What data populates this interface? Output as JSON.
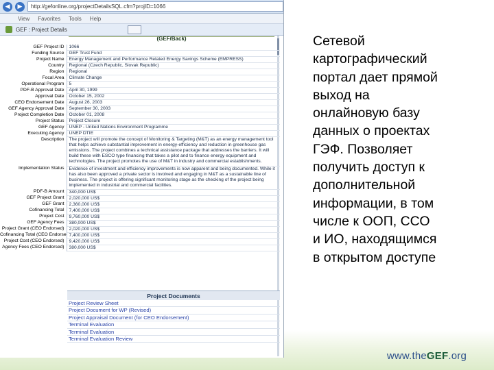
{
  "slide": {
    "lines": [
      "Сетевой",
      "картографический",
      "портал дает прямой",
      "выход на",
      "онлайновую базу",
      "данных о проектах",
      "ГЭФ. Позволяет",
      "получить доступ к",
      "дополнительной",
      "информации, в том",
      "числе к ООП, ССО",
      "и ИО, находящимся",
      "в открытом доступе"
    ],
    "footer_prefix": "www.the",
    "footer_brand": "GEF",
    "footer_suffix": ".org",
    "band_color": "#dcebc9"
  },
  "browser": {
    "url": "http://gefonline.org/projectDetailsSQL.cfm?projID=1066",
    "menu": [
      "View",
      "Favorites",
      "Tools",
      "Help"
    ],
    "tab_title": "GEF : Project Details",
    "page_title": "(GEF/Back)"
  },
  "project_details": [
    {
      "label": "GEF Project ID",
      "value": "1066"
    },
    {
      "label": "Funding Source",
      "value": "GEF Trust Fund"
    },
    {
      "label": "Project Name",
      "value": "Energy Management and Performance Related Energy Savings Scheme (EMPRESS)"
    },
    {
      "label": "Country",
      "value": "Regional (Czech Republic, Slovak Republic)"
    },
    {
      "label": "Region",
      "value": "Regional"
    },
    {
      "label": "Focal Area",
      "value": "Climate Change"
    },
    {
      "label": "Operational Program",
      "value": "5"
    },
    {
      "label": "PDF-B Approval Date",
      "value": "April 30, 1999"
    },
    {
      "label": "Approval Date",
      "value": "October 15, 2002"
    },
    {
      "label": "CEO Endorsement Date",
      "value": "August 26, 2003"
    },
    {
      "label": "GEF Agency Approval Date",
      "value": "September 30, 2003"
    },
    {
      "label": "Project Completion Date",
      "value": "October 01, 2008"
    },
    {
      "label": "Project Status",
      "value": "Project Closure"
    },
    {
      "label": "GEF Agency",
      "value": "UNEP - United Nations Environment Programme"
    },
    {
      "label": "Executing Agency",
      "value": "UNEP DTIE"
    },
    {
      "label": "Description",
      "value": "The project will promote the concept of Monitoring & Targeting (M&T) as an energy management tool that helps achieve substantial improvement in energy-efficiency and reduction in greenhouse gas emissions. The project combines a technical assistance package that addresses the barriers. It will build these with ESCO type financing that takes a pilot and to finance energy equipment and technologies. The project promotes the use of M&T in industry and commercial establishments."
    },
    {
      "label": "Implementation Status",
      "value": "Evidence of investment and efficiency improvements is now apparent and being documented. While it has also been approved a private sector is involved and engaging in M&T as a sustainable line of business. The project is offering significant monitoring stage as the checking of the project being implemented in industrial and commercial facilities."
    },
    {
      "label": "PDF-B Amount",
      "value": "340,000 US$"
    },
    {
      "label": "GEF Project Grant",
      "value": "2,020,000 US$"
    },
    {
      "label": "GEF Grant",
      "value": "2,360,000 US$"
    },
    {
      "label": "Cofinancing Total",
      "value": "7,400,000 US$"
    },
    {
      "label": "Project Cost",
      "value": "9,760,000 US$"
    },
    {
      "label": "GEF Agency Fees",
      "value": "380,000 US$"
    },
    {
      "label": "Project Grant (CEO Endorsed)",
      "value": "2,020,000 US$"
    },
    {
      "label": "Cofinancing Total (CEO Endorsed)",
      "value": "7,400,000 US$"
    },
    {
      "label": "Project Cost (CEO Endorsed)",
      "value": "9,420,000 US$"
    },
    {
      "label": "Agency Fees (CEO Endorsed)",
      "value": "380,000 US$"
    }
  ],
  "project_documents": {
    "header": "Project Documents",
    "links": [
      "Project Review Sheet",
      "Project Document for WP (Revised)",
      "Project Appraisal Document (for CEO Endorsement)",
      "Terminal Evaluation",
      "Terminal Evaluation",
      "Terminal Evaluation Review"
    ]
  }
}
